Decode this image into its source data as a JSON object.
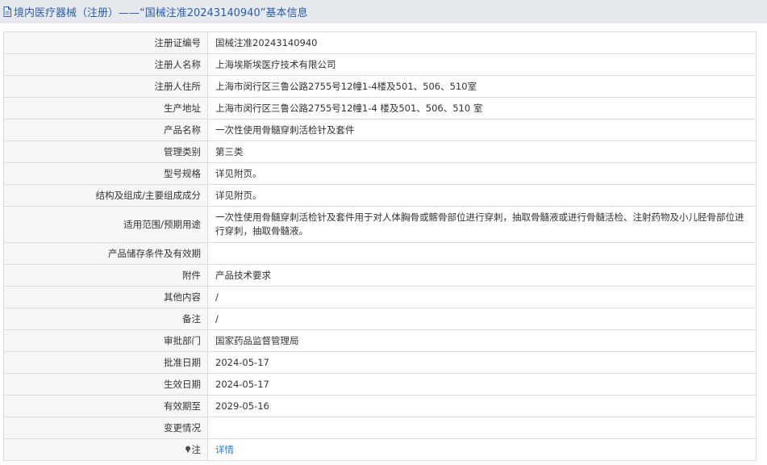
{
  "header": {
    "title": "境内医疗器械（注册）——“国械注准20243140940”基本信息",
    "icon": "document-icon",
    "title_color": "#2a5caa",
    "bar_color": "#e6e9ee"
  },
  "rows": [
    {
      "label": "注册证编号",
      "value": "国械注准20243140940"
    },
    {
      "label": "注册人名称",
      "value": "上海埃斯埃医疗技术有限公司"
    },
    {
      "label": "注册人住所",
      "value": "上海市闵行区三鲁公路2755号12幢1-4楼及501、506、510室"
    },
    {
      "label": "生产地址",
      "value": "上海市闵行区三鲁公路2755号12幢1-4 楼及501、506、510 室"
    },
    {
      "label": "产品名称",
      "value": "一次性使用骨髓穿刺活检针及套件"
    },
    {
      "label": "管理类别",
      "value": "第三类"
    },
    {
      "label": "型号规格",
      "value": "详见附页。"
    },
    {
      "label": "结构及组成/主要组成成分",
      "value": "详见附页。"
    },
    {
      "label": "适用范围/预期用途",
      "value": "一次性使用骨髓穿刺活检针及套件用于对人体胸骨或髂骨部位进行穿刺，抽取骨髓液或进行骨髓活检、注射药物及小儿胫骨部位进行穿刺，抽取骨髓液。"
    },
    {
      "label": "产品储存条件及有效期",
      "value": ""
    },
    {
      "label": "附件",
      "value": "产品技术要求"
    },
    {
      "label": "其他内容",
      "value": "/"
    },
    {
      "label": "备注",
      "value": "/"
    },
    {
      "label": "审批部门",
      "value": "国家药品监督管理局"
    },
    {
      "label": "批准日期",
      "value": "2024-05-17"
    },
    {
      "label": "生效日期",
      "value": "2024-05-17"
    },
    {
      "label": "有效期至",
      "value": "2029-05-16"
    },
    {
      "label": "变更情况",
      "value": ""
    }
  ],
  "note": {
    "label": "注",
    "icon": "pin-icon",
    "link_text": "详情",
    "link_color": "#2a7ad2"
  }
}
